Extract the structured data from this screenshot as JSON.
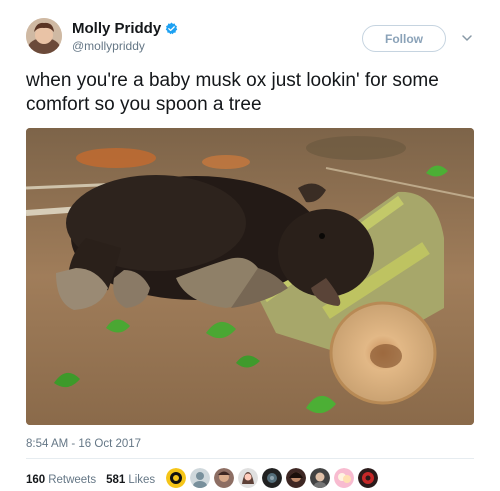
{
  "author": {
    "display_name": "Molly Priddy",
    "handle": "@mollypriddy",
    "verified": true
  },
  "follow_button": {
    "label": "Follow"
  },
  "tweet": {
    "text": "when you're a baby musk ox just lookin' for some comfort so you spoon a tree",
    "timestamp": "8:54 AM - 16 Oct 2017"
  },
  "stats": {
    "retweets_count": "160",
    "retweets_label": "Retweets",
    "likes_count": "581",
    "likes_label": "Likes"
  },
  "colors": {
    "verified_blue": "#1da1f2",
    "follow_border": "#c6d4e0",
    "secondary_text": "#657786"
  },
  "icons": [
    "verified-badge-icon",
    "chevron-down-icon"
  ],
  "liker_avatar_count": 9
}
